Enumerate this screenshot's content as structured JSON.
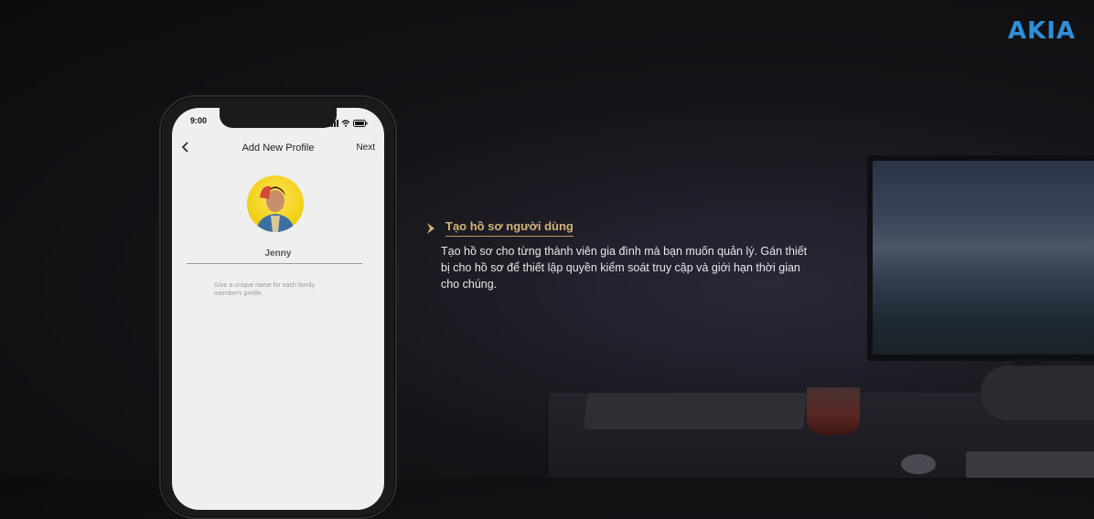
{
  "brand": {
    "logo_text": "AKIA",
    "color": "#2f8fd6"
  },
  "phone": {
    "status_time": "9:00",
    "nav": {
      "back_icon": "chevron-left-icon",
      "title": "Add New Profile",
      "next_label": "Next"
    },
    "profile": {
      "name_value": "Jenny",
      "hint": "Give a unique name for each family member's profile."
    }
  },
  "feature": {
    "title": "Tạo hồ sơ người dùng",
    "description": "Tạo hồ sơ cho từng thành viên gia đình mà bạn muốn quản lý. Gán thiết bị cho hồ sơ để thiết lập quyền kiểm soát truy cập và giới hạn thời gian cho chúng.",
    "accent_color": "#d4b276"
  }
}
